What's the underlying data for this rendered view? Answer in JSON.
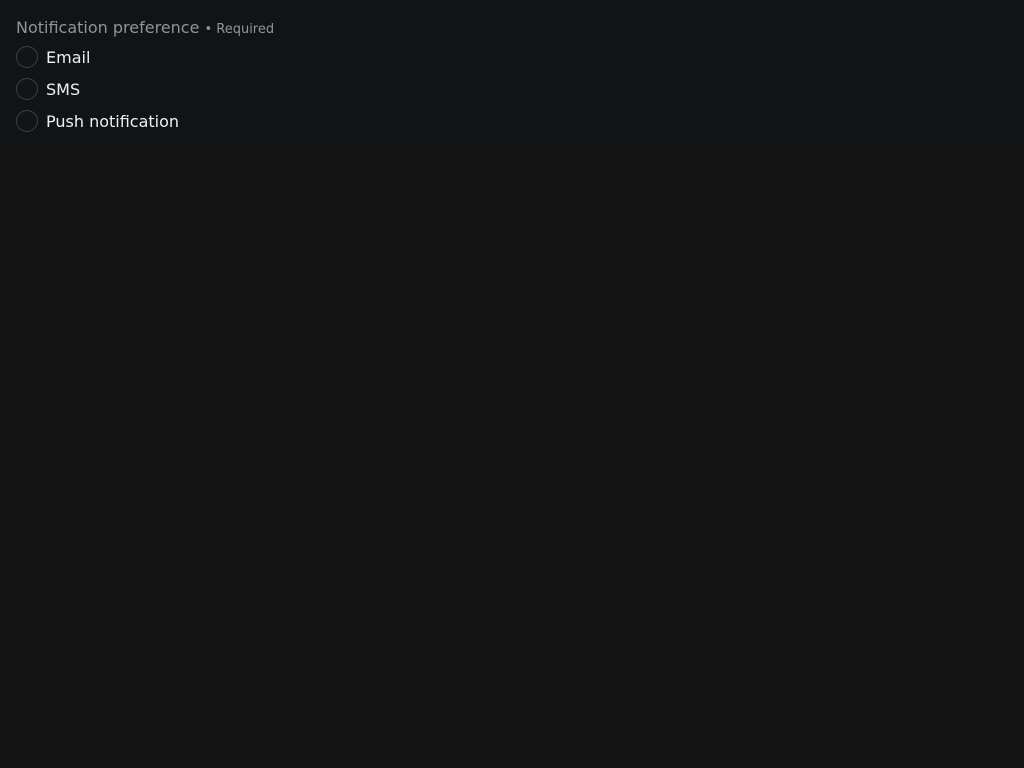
{
  "fieldset": {
    "legend": "Notification preference",
    "required": "• Required",
    "options": [
      {
        "label": "Email",
        "checked": false
      },
      {
        "label": "SMS",
        "checked": false
      },
      {
        "label": "Push notification",
        "checked": false
      }
    ]
  },
  "colors": {
    "page_background": "#151414",
    "panel_background": "#111416",
    "legend_text": "#8d959d",
    "option_text": "#eef0f2",
    "radio_border": "#3b4046"
  }
}
